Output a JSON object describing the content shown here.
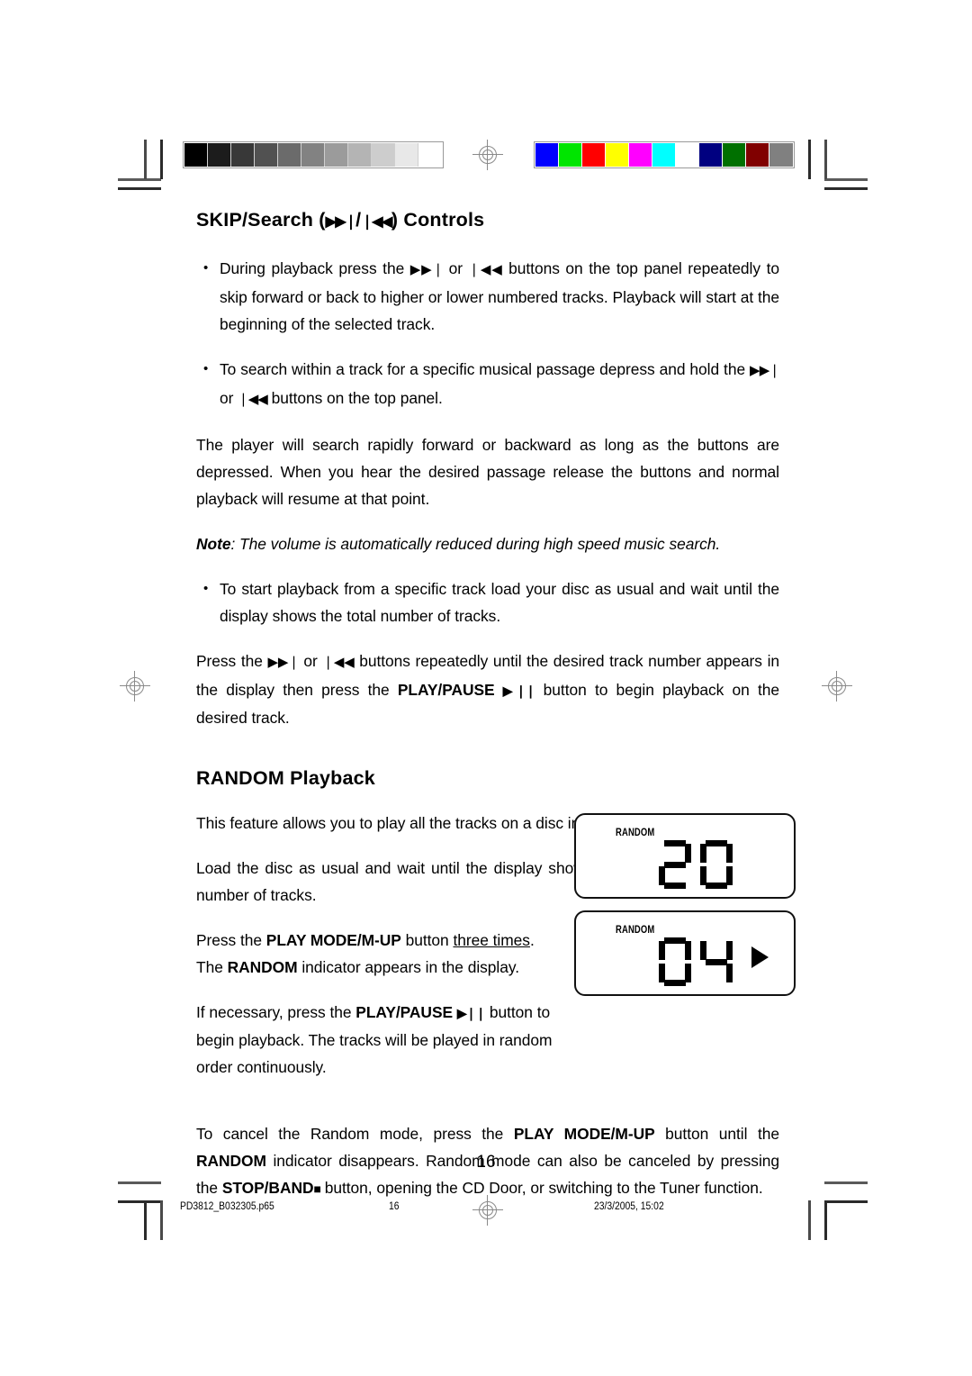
{
  "document": {
    "page_number": "16",
    "footer": {
      "filename": "PD3812_B032305.p65",
      "page": "16",
      "timestamp": "23/3/2005, 15:02"
    }
  },
  "print_bars": {
    "grayscale_label": "grayscale-calibration-bar",
    "grayscale": [
      "#000000",
      "#1c1c1c",
      "#383838",
      "#515151",
      "#6b6b6b",
      "#828282",
      "#9b9b9b",
      "#b4b4b4",
      "#cdcdcd",
      "#e8e8e8",
      "#ffffff"
    ],
    "color_label": "color-calibration-bar",
    "colors": [
      "#0000ff",
      "#00e500",
      "#ff0000",
      "#ffff00",
      "#ff00ff",
      "#00ffff",
      "#ffffff",
      "#000080",
      "#007000",
      "#800000",
      "#808080"
    ]
  },
  "sections": {
    "skip_search": {
      "title_prefix": "SKIP/Search (",
      "title_sym_forward": "▶▶❘",
      "title_sep": "/",
      "title_sym_back": "❘◀◀",
      "title_suffix": ") Controls",
      "bullet1": {
        "t1": "During playback press the ",
        "s1": "▶▶❘",
        "t2": " or ",
        "s2": "❘◀◀",
        "t3": " buttons on the top panel repeatedly to skip forward or back to higher or lower numbered tracks. Playback will start at the beginning of the selected track."
      },
      "bullet2": {
        "t1": "To search within a track for a specific musical passage depress and hold the ",
        "s1": "▶▶❘",
        "t2": " or ",
        "s2": "❘◀◀",
        "t3": " buttons on the top panel."
      },
      "para_search": "The player will search rapidly forward or backward as long as the buttons are depressed. When you hear the desired passage release the buttons and normal playback will resume at that point.",
      "note": {
        "label": "Note",
        "text": ": The volume is automatically reduced during high speed music search."
      },
      "bullet3": "To start playback from a specific track load your disc as usual and wait until the display shows the total number of tracks.",
      "para_press": {
        "t1": "Press the ",
        "s1": "▶▶❘",
        "t2": " or ",
        "s2": "❘◀◀",
        "t3": " buttons repeatedly until the desired track number appears in the display then press the ",
        "b1": "PLAY/PAUSE",
        "s3": "▶❘❘",
        "t4": " button to begin playback on the desired track."
      }
    },
    "random_playback": {
      "title": "RANDOM Playback",
      "para_intro": "This feature allows you to play all the tracks on a disc in random order.",
      "para_load": "Load the disc as usual and wait until the display shows the total playing time and number of tracks.",
      "para_mode": {
        "t1": "Press the ",
        "b1": "PLAY MODE/M-UP",
        "t2": " button ",
        "u1": "three times",
        "t3": ". The ",
        "b2": "RANDOM",
        "t4": " indicator appears in the display."
      },
      "para_begin": {
        "t1": "If necessary, press the ",
        "b1": "PLAY/PAUSE",
        "s1": "▶❘❘",
        "t2": " button to begin playback. The tracks will be played in random order continuously."
      },
      "para_cancel": {
        "t1": "To cancel the Random mode, press the ",
        "b1": "PLAY MODE/M-UP",
        "t2": " button until the ",
        "b2": "RANDOM",
        "t3": " indicator disappears. Random mode can also be canceled by pressing the ",
        "b3": "STOP/BAND",
        "s1": "■",
        "t4": " button, opening the CD Door, or switching to the Tuner function."
      }
    }
  },
  "lcd_displays": [
    {
      "indicator": "RANDOM",
      "digits": "20",
      "play_arrow": false
    },
    {
      "indicator": "RANDOM",
      "digits": "04",
      "play_arrow": true
    }
  ]
}
